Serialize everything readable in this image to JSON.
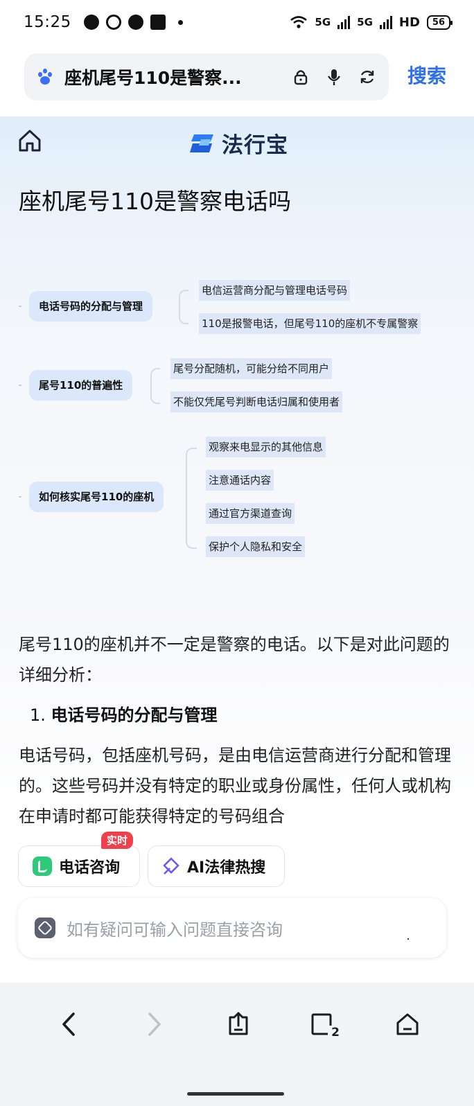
{
  "status_bar": {
    "time": "15:25",
    "network_1": "5G",
    "network_2": "5G",
    "hd": "HD",
    "battery": "56",
    "icons": [
      "chat-bubble-icon",
      "app-icon",
      "message-icon",
      "media-icon",
      "dot-icon",
      "wifi-icon",
      "signal-icon",
      "signal-icon"
    ]
  },
  "search": {
    "query": "座机尾号110是警察...",
    "button_label": "搜索",
    "icons": [
      "baidu-paw-icon",
      "lock-icon",
      "microphone-icon",
      "refresh-icon"
    ]
  },
  "header": {
    "logo_text": "法行宝",
    "icons": [
      "home-icon",
      "logo-mark-icon"
    ]
  },
  "article": {
    "title": "座机尾号110是警察电话吗",
    "intro": "尾号110的座机并不一定是警察的电话。以下是对此问题的详细分析：",
    "section_1_number": "1.",
    "section_1_title": "电话号码的分配与管理",
    "section_1_body": "电话号码，包括座机号码，是由电信运营商进行分配和管理的。这些号码并没有特定的职业或身份属性，任何人或机构在申请时都可能获得特定的号码组合"
  },
  "mindmap": {
    "branches": [
      {
        "label": "电话号码的分配与管理",
        "leaves": [
          "电信运营商分配与管理电话号码",
          "110是报警电话，但尾号110的座机不专属警察"
        ]
      },
      {
        "label": "尾号110的普遍性",
        "leaves": [
          "尾号分配随机，可能分给不同用户",
          "不能仅凭尾号判断电话归属和使用者"
        ]
      },
      {
        "label": "如何核实尾号110的座机",
        "leaves": [
          "观察来电显示的其他信息",
          "注意通话内容",
          "通过官方渠道查询",
          "保护个人隐私和安全"
        ]
      }
    ]
  },
  "actions": {
    "phone_consult": "电话咨询",
    "badge": "实时",
    "ai_search": "AI法律热搜",
    "ask_placeholder": "如有疑问可输入问题直接咨询",
    "icons": [
      "phone-icon",
      "ai-search-icon",
      "chat-input-icon"
    ]
  },
  "navbar": {
    "tab_count": "2",
    "icons": [
      "back-icon",
      "forward-icon",
      "share-icon",
      "tabs-icon",
      "home-nav-icon"
    ]
  },
  "colors": {
    "accent": "#2f6fe8",
    "badge": "#f0404b",
    "node_bg": "#dbe8fb",
    "phone_green": "#2ec97a"
  }
}
